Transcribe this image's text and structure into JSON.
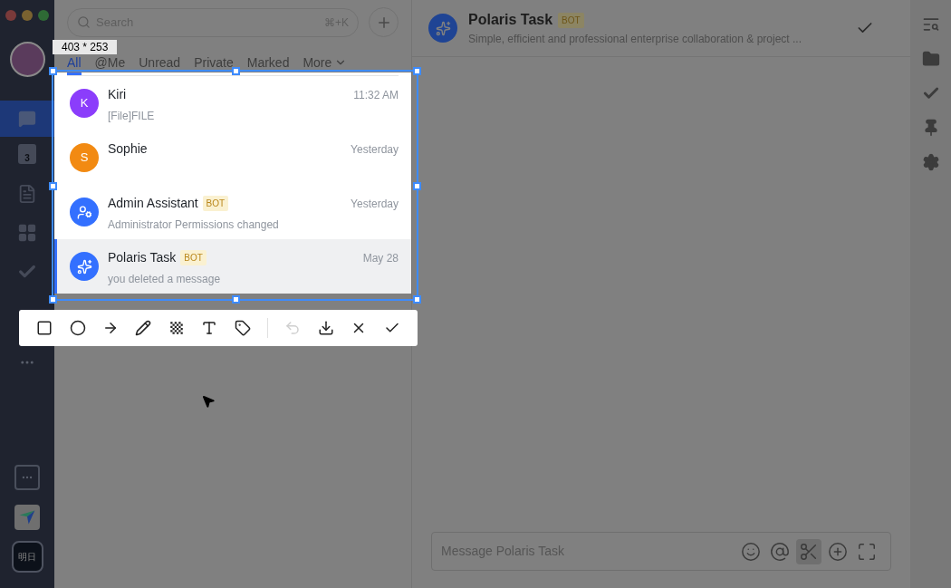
{
  "search": {
    "placeholder": "Search",
    "shortcut": "⌘+K"
  },
  "tabs": [
    {
      "label": "All",
      "selected": true
    },
    {
      "label": "@Me",
      "selected": false
    },
    {
      "label": "Unread",
      "selected": false
    },
    {
      "label": "Private",
      "selected": false
    },
    {
      "label": "Marked",
      "selected": false
    },
    {
      "label": "More",
      "selected": false
    }
  ],
  "chats": [
    {
      "kind": "letter",
      "initial": "K",
      "color": "#8b3dfb",
      "name": "Kiri",
      "time": "11:32 AM",
      "preview": "[File]FILE",
      "selected": false
    },
    {
      "kind": "letter",
      "initial": "S",
      "color": "#f28a12",
      "name": "Sophie",
      "time": "Yesterday",
      "selected": false
    },
    {
      "kind": "admin",
      "color": "#3370ff",
      "name": "Admin Assistant",
      "badge": "BOT",
      "time": "Yesterday",
      "preview": "Administrator Permissions changed",
      "selected": false
    },
    {
      "kind": "task",
      "color": "#3370ff",
      "name": "Polaris Task",
      "badge": "BOT",
      "time": "May 28",
      "preview": "you deleted a message",
      "selected": true
    }
  ],
  "sidebar": {
    "calendar_day": "3",
    "workspace_label": "明日"
  },
  "capture": {
    "size_label": "403 * 253",
    "tools": [
      {
        "kind": "rectangle",
        "disabled": false
      },
      {
        "kind": "ellipse",
        "disabled": false
      },
      {
        "kind": "arrow",
        "disabled": false
      },
      {
        "kind": "pen",
        "disabled": false
      },
      {
        "kind": "mosaic",
        "disabled": false
      },
      {
        "kind": "text",
        "disabled": false
      },
      {
        "kind": "tag",
        "disabled": false
      },
      {
        "kind": "divider"
      },
      {
        "kind": "undo",
        "disabled": true
      },
      {
        "kind": "download",
        "disabled": false
      },
      {
        "kind": "cancel",
        "disabled": false
      },
      {
        "kind": "confirm",
        "disabled": false
      }
    ]
  },
  "chat": {
    "title": "Polaris Task",
    "badge": "BOT",
    "subtitle": "Simple, efficient and professional enterprise collaboration & project ...",
    "input_placeholder": "Message Polaris Task",
    "input_tools": [
      {
        "kind": "emoji",
        "selected": false
      },
      {
        "kind": "mention",
        "selected": false
      },
      {
        "kind": "screenshot",
        "selected": true
      },
      {
        "kind": "attach",
        "selected": false
      },
      {
        "kind": "expand",
        "selected": false
      }
    ]
  }
}
